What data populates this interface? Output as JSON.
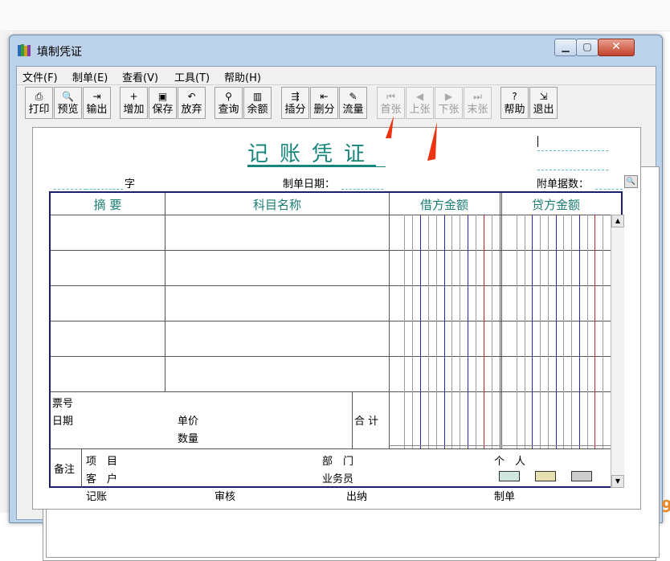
{
  "window": {
    "title": "填制凭证"
  },
  "menu": [
    {
      "label": "文件(F)"
    },
    {
      "label": "制单(E)"
    },
    {
      "label": "查看(V)"
    },
    {
      "label": "工具(T)"
    },
    {
      "label": "帮助(H)"
    }
  ],
  "toolbar": [
    {
      "label": "打印",
      "icon": "printer-icon",
      "glyph": "⎙",
      "disabled": false
    },
    {
      "label": "预览",
      "icon": "preview-icon",
      "glyph": "🔍",
      "disabled": false
    },
    {
      "label": "输出",
      "icon": "export-icon",
      "glyph": "⇥",
      "disabled": false
    },
    {
      "label": "增加",
      "icon": "add-icon",
      "glyph": "+",
      "disabled": false
    },
    {
      "label": "保存",
      "icon": "save-icon",
      "glyph": "▣",
      "disabled": false
    },
    {
      "label": "放弃",
      "icon": "undo-icon",
      "glyph": "↶",
      "disabled": false
    },
    {
      "label": "查询",
      "icon": "binoculars-icon",
      "glyph": "⚲",
      "disabled": false
    },
    {
      "label": "余额",
      "icon": "balance-chart-icon",
      "glyph": "▥",
      "disabled": false
    },
    {
      "label": "插分",
      "icon": "insert-row-icon",
      "glyph": "⇶",
      "disabled": false
    },
    {
      "label": "删分",
      "icon": "delete-row-icon",
      "glyph": "⇤",
      "disabled": false
    },
    {
      "label": "流量",
      "icon": "cashflow-icon",
      "glyph": "✎",
      "disabled": false
    },
    {
      "label": "首张",
      "icon": "first-record-icon",
      "glyph": "⏮",
      "disabled": true
    },
    {
      "label": "上张",
      "icon": "prev-record-icon",
      "glyph": "◀",
      "disabled": true
    },
    {
      "label": "下张",
      "icon": "next-record-icon",
      "glyph": "▶",
      "disabled": true
    },
    {
      "label": "末张",
      "icon": "last-record-icon",
      "glyph": "⏭",
      "disabled": true
    },
    {
      "label": "帮助",
      "icon": "help-icon",
      "glyph": "?",
      "disabled": false
    },
    {
      "label": "退出",
      "icon": "exit-icon",
      "glyph": "⇲",
      "disabled": false
    }
  ],
  "voucher": {
    "title": "记账凭证",
    "zi_label": "字",
    "date_label": "制单日期：",
    "attachments_label": "附单据数：",
    "columns": {
      "summary": "摘 要",
      "account": "科目名称",
      "debit": "借方金额",
      "credit": "贷方金额"
    },
    "bill_no_label": "票号",
    "date_row_label": "日期",
    "unit_price_label": "单价",
    "quantity_label": "数量",
    "total_label": "合 计",
    "remark_label": "备注",
    "project_label": "项　目",
    "customer_label": "客　户",
    "department_label": "部　门",
    "salesman_label": "业务员",
    "person_label": "个　人"
  },
  "footer": {
    "bookkeeper": "记账",
    "auditor": "审核",
    "cashier": "出纳",
    "preparer": "制单"
  },
  "colors": {
    "title_teal": "#16867b",
    "grid_border": "#1a1e6e",
    "blue_rule": "#2a2aa8",
    "red_rule": "#c0262a",
    "arrow_red": "#ee3311"
  }
}
